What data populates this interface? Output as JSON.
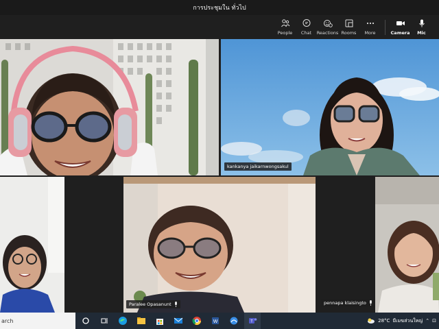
{
  "window": {
    "title": "การประชุมใน ทั่วไป"
  },
  "toolbar": {
    "buttons": [
      {
        "label": "People",
        "icon": "people-icon"
      },
      {
        "label": "Chat",
        "icon": "chat-icon"
      },
      {
        "label": "Reactions",
        "icon": "reactions-icon"
      },
      {
        "label": "Rooms",
        "icon": "rooms-icon"
      },
      {
        "label": "More",
        "icon": "more-icon"
      },
      {
        "label": "Camera",
        "icon": "camera-icon"
      },
      {
        "label": "Mic",
        "icon": "mic-icon"
      }
    ]
  },
  "participants": [
    {
      "name": ""
    },
    {
      "name": "kankanya jaikarnwongsakul"
    },
    {
      "name": ""
    },
    {
      "name": "Paralee Opasanunt"
    },
    {
      "name": "pennapa klaisingto"
    }
  ],
  "taskbar": {
    "search_text": "arch",
    "weather_temp": "28°C",
    "weather_desc": "มีเมฆส่วนใหญ่",
    "apps": [
      "task-view-icon",
      "edge-icon",
      "file-explorer-icon",
      "store-icon",
      "mail-icon",
      "chrome-icon",
      "word-icon",
      "photos-icon",
      "teams-icon"
    ]
  }
}
